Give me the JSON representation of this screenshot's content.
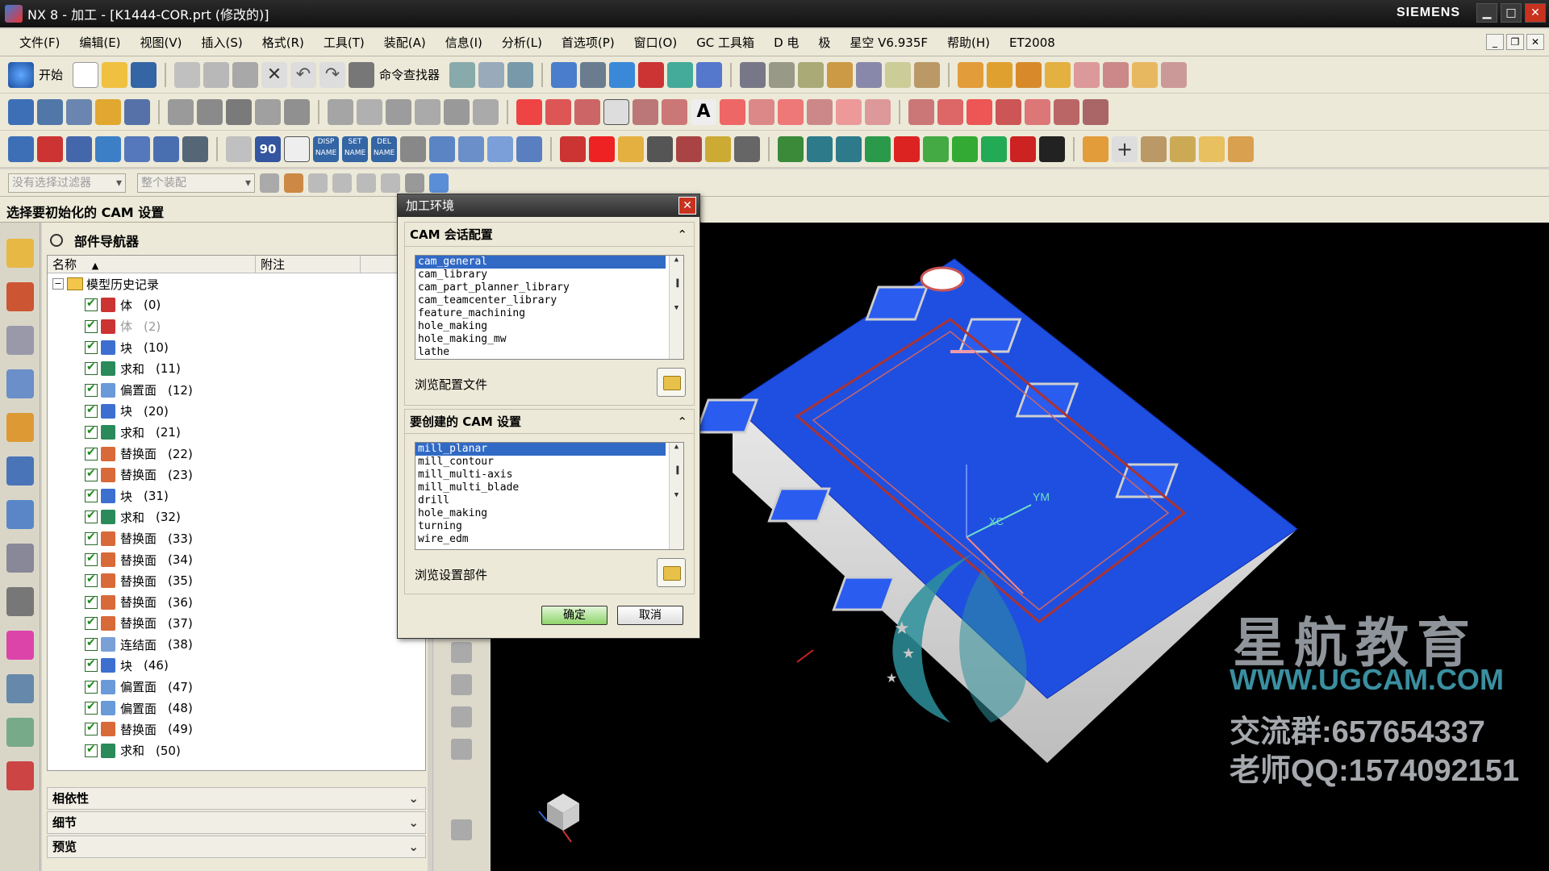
{
  "window": {
    "title": "NX 8 - 加工 - [K1444-COR.prt (修改的)]",
    "brand": "SIEMENS"
  },
  "menu": [
    "文件(F)",
    "编辑(E)",
    "视图(V)",
    "插入(S)",
    "格式(R)",
    "工具(T)",
    "装配(A)",
    "信息(I)",
    "分析(L)",
    "首选项(P)",
    "窗口(O)",
    "GC 工具箱",
    "D 电",
    "极",
    "星空 V6.935F",
    "帮助(H)",
    "ET2008"
  ],
  "toolbar": {
    "start_label": "开始",
    "command_finder": "命令查找器"
  },
  "selection_bar": {
    "filter": "没有选择过滤器",
    "scope": "整个装配"
  },
  "prompt": "选择要初始化的 CAM 设置",
  "navigator": {
    "title": "部件导航器",
    "col_name": "名称",
    "col_note": "附注",
    "root": "模型历史记录",
    "rows": [
      {
        "label": "体",
        "id": "(0)",
        "grey": false
      },
      {
        "label": "体",
        "id": "(2)",
        "grey": true
      },
      {
        "label": "块",
        "id": "(10)",
        "grey": false
      },
      {
        "label": "求和",
        "id": "(11)",
        "grey": false
      },
      {
        "label": "偏置面",
        "id": "(12)",
        "grey": false
      },
      {
        "label": "块",
        "id": "(20)",
        "grey": false
      },
      {
        "label": "求和",
        "id": "(21)",
        "grey": false
      },
      {
        "label": "替换面",
        "id": "(22)",
        "grey": false
      },
      {
        "label": "替换面",
        "id": "(23)",
        "grey": false
      },
      {
        "label": "块",
        "id": "(31)",
        "grey": false
      },
      {
        "label": "求和",
        "id": "(32)",
        "grey": false
      },
      {
        "label": "替换面",
        "id": "(33)",
        "grey": false
      },
      {
        "label": "替换面",
        "id": "(34)",
        "grey": false
      },
      {
        "label": "替换面",
        "id": "(35)",
        "grey": false
      },
      {
        "label": "替换面",
        "id": "(36)",
        "grey": false
      },
      {
        "label": "替换面",
        "id": "(37)",
        "grey": false
      },
      {
        "label": "连结面",
        "id": "(38)",
        "grey": false
      },
      {
        "label": "块",
        "id": "(46)",
        "grey": false
      },
      {
        "label": "偏置面",
        "id": "(47)",
        "grey": false
      },
      {
        "label": "偏置面",
        "id": "(48)",
        "grey": false
      },
      {
        "label": "替换面",
        "id": "(49)",
        "grey": false
      },
      {
        "label": "求和",
        "id": "(50)",
        "grey": false
      }
    ],
    "sections": [
      "相依性",
      "细节",
      "预览"
    ]
  },
  "dialog": {
    "title": "加工环境",
    "session_header": "CAM 会话配置",
    "session_items": [
      "cam_general",
      "cam_library",
      "cam_part_planner_library",
      "cam_teamcenter_library",
      "feature_machining",
      "hole_making",
      "hole_making_mw",
      "lathe"
    ],
    "browse_config": "浏览配置文件",
    "setup_header": "要创建的 CAM 设置",
    "setup_items": [
      "mill_planar",
      "mill_contour",
      "mill_multi-axis",
      "mill_multi_blade",
      "drill",
      "hole_making",
      "turning",
      "wire_edm"
    ],
    "browse_setup": "浏览设置部件",
    "ok": "确定",
    "cancel": "取消"
  },
  "watermark": {
    "brand": "星航教育",
    "url": "WWW.UGCAM.COM",
    "group": "交流群:657654337",
    "qq": "老师QQ:1574092151"
  },
  "viewport_labels": {
    "ym": "YM",
    "xc": "XC"
  }
}
